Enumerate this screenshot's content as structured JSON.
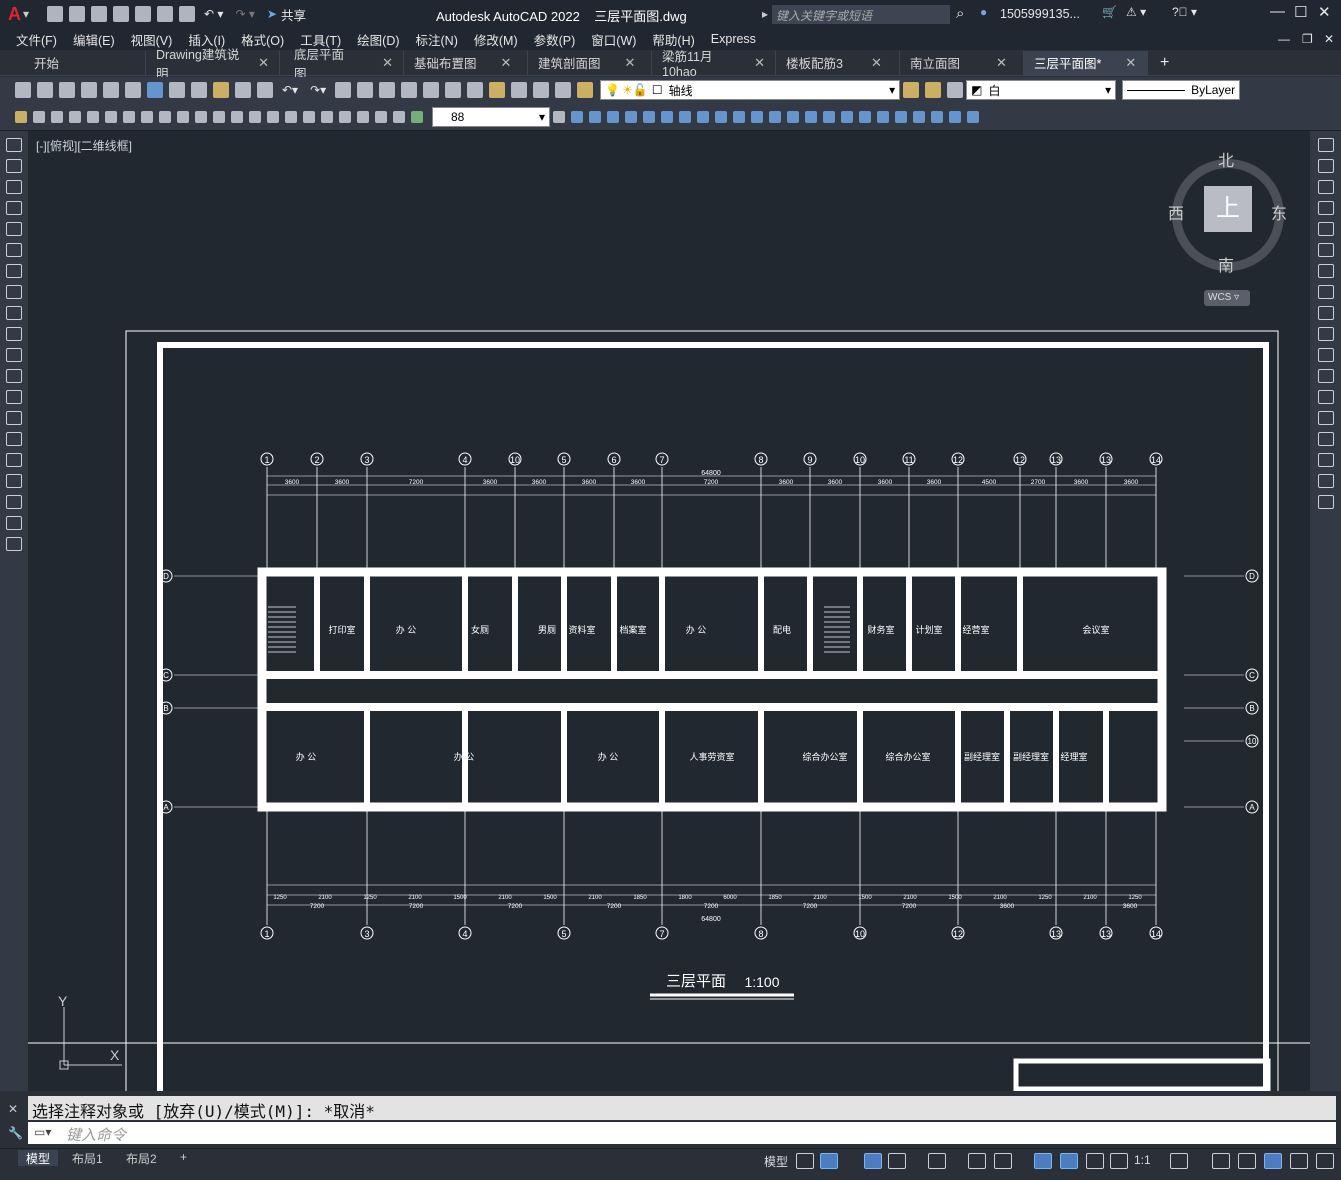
{
  "app": {
    "title": "Autodesk AutoCAD 2022",
    "file": "三层平面图.dwg",
    "share": "共享",
    "search_placeholder": "键入关键字或短语",
    "user": "1505999135...",
    "logo": "A"
  },
  "menu": [
    "文件(F)",
    "编辑(E)",
    "视图(V)",
    "插入(I)",
    "格式(O)",
    "工具(T)",
    "绘图(D)",
    "标注(N)",
    "修改(M)",
    "参数(P)",
    "窗口(W)",
    "帮助(H)",
    "Express"
  ],
  "tabs": [
    {
      "label": "开始"
    },
    {
      "label": "Drawing建筑说明"
    },
    {
      "label": "底层平面图"
    },
    {
      "label": "基础布置图"
    },
    {
      "label": "建筑剖面图"
    },
    {
      "label": "梁筋11月10hao"
    },
    {
      "label": "楼板配筋3"
    },
    {
      "label": "南立面图"
    },
    {
      "label": "三层平面图*"
    }
  ],
  "toolbar": {
    "layer": "轴线",
    "color": "白",
    "linetype": "ByLayer",
    "dimscale": "88"
  },
  "viewport": {
    "label": "[-][俯视][二维线框]"
  },
  "viewcube": {
    "north": "北",
    "south": "南",
    "east": "东",
    "west": "西",
    "top": "上",
    "wcs": "WCS"
  },
  "ucs": {
    "y": "Y",
    "x": "X"
  },
  "drawing": {
    "title": "三层平面",
    "scale": "1:100",
    "axes_top": [
      "1",
      "2",
      "3",
      "4",
      "10",
      "5",
      "6",
      "7",
      "8",
      "9",
      "10",
      "11",
      "12",
      "12",
      "13",
      "13",
      "14"
    ],
    "axes_bottom": [
      "1",
      "3",
      "4",
      "5",
      "7",
      "8",
      "10",
      "12",
      "13",
      "13",
      "14"
    ],
    "axes_right": [
      "D",
      "C",
      "B",
      "10",
      "A"
    ],
    "axes_left": [
      "D",
      "C",
      "B",
      "A"
    ],
    "total_dim": "64800",
    "rooms_top": [
      "打印室",
      "办 公",
      "女厕",
      "男厕",
      "资料室",
      "档案室",
      "办 公",
      "配电",
      "财务室",
      "计划室",
      "经营室",
      "会议室"
    ],
    "rooms_bottom": [
      "办 公",
      "办 公",
      "办 公",
      "人事劳资室",
      "综合办公室",
      "综合办公室",
      "副经理室",
      "副经理室",
      "经理室"
    ],
    "top_dims": [
      "3600",
      "3600",
      "7200",
      "3600",
      "3600",
      "3600",
      "3600",
      "7200",
      "3600",
      "3600",
      "3600",
      "3600",
      "4500",
      "2700",
      "3600",
      "3600"
    ],
    "bottom_dims": [
      "7200",
      "7200",
      "7200",
      "7200",
      "7200",
      "7200",
      "7200",
      "3600",
      "3600"
    ],
    "bottom_dims_sub": [
      "1250",
      "2100",
      "1250",
      "2100",
      "1500",
      "2100",
      "1500",
      "2100",
      "1850",
      "1800",
      "6000",
      "1850",
      "2100",
      "1500",
      "2100",
      "1500",
      "2100",
      "1250",
      "2100",
      "1250"
    ]
  },
  "command": {
    "history": "选择注释对象或 [放弃(U)/模式(M)]: *取消*",
    "placeholder": "键入命令"
  },
  "layouts": [
    "模型",
    "布局1",
    "布局2"
  ],
  "status": {
    "model": "模型",
    "annoscale": "1:1"
  }
}
